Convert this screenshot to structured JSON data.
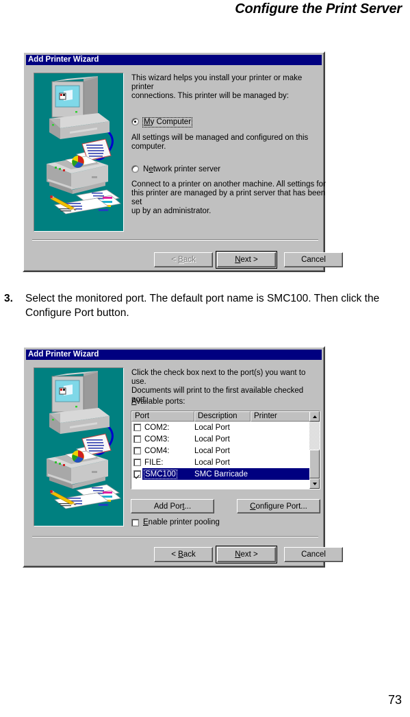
{
  "page": {
    "header": "Configure the Print Server",
    "number": "73"
  },
  "step": {
    "number": "3.",
    "text": "Select the monitored port. The default port name is SMC100. Then click the Configure Port button."
  },
  "dialog1": {
    "title": "Add Printer Wizard",
    "intro_line1": "This wizard helps you install your printer or make printer",
    "intro_line2": "connections.  This printer will be managed by:",
    "option1": {
      "label_underlined": "M",
      "label_rest": "y Computer",
      "selected": true,
      "desc_line1": "All settings will be managed and configured on this",
      "desc_line2": "computer."
    },
    "option2": {
      "label_pre": "N",
      "label_underlined": "e",
      "label_rest": "twork printer server",
      "selected": false,
      "desc_line1": "Connect to a printer on another machine.  All settings for",
      "desc_line2": "this printer are managed by a print server that has been set",
      "desc_line3": "up by an administrator."
    },
    "buttons": {
      "back_pre": "< ",
      "back_underlined": "B",
      "back_rest": "ack",
      "back_disabled": true,
      "next_pre": "",
      "next_underlined": "N",
      "next_rest": "ext >",
      "next_default": true,
      "cancel": "Cancel"
    }
  },
  "dialog2": {
    "title": "Add Printer Wizard",
    "intro_line1": "Click the check box next to the port(s) you want to use.",
    "intro_line2": "Documents will print to the first available checked port.",
    "available_label_underlined": "A",
    "available_label_rest": "vailable ports:",
    "list": {
      "columns": [
        "Port",
        "Description",
        "Printer"
      ],
      "rows": [
        {
          "port": "COM2:",
          "description": "Local Port",
          "printer": "",
          "checked": false,
          "selected": false
        },
        {
          "port": "COM3:",
          "description": "Local Port",
          "printer": "",
          "checked": false,
          "selected": false
        },
        {
          "port": "COM4:",
          "description": "Local Port",
          "printer": "",
          "checked": false,
          "selected": false
        },
        {
          "port": "FILE:",
          "description": "Local Port",
          "printer": "",
          "checked": false,
          "selected": false
        },
        {
          "port": "SMC100",
          "description": "SMC Barricade",
          "printer": "",
          "checked": true,
          "selected": true
        }
      ]
    },
    "add_port": {
      "pre": "Add Por",
      "underlined": "t",
      "rest": "..."
    },
    "configure_port": {
      "underlined": "C",
      "rest": "onfigure Port..."
    },
    "pooling": {
      "pre": "",
      "underlined": "E",
      "rest": "nable printer pooling",
      "checked": false
    },
    "buttons": {
      "back_pre": "< ",
      "back_underlined": "B",
      "back_rest": "ack",
      "back_disabled": false,
      "next_underlined": "N",
      "next_rest": "ext >",
      "next_default": true,
      "cancel": "Cancel"
    }
  },
  "colors": {
    "titlebar": "#000080",
    "dialog_face": "#c0c0c0",
    "illustration_bg": "#008080",
    "selection": "#000080"
  }
}
